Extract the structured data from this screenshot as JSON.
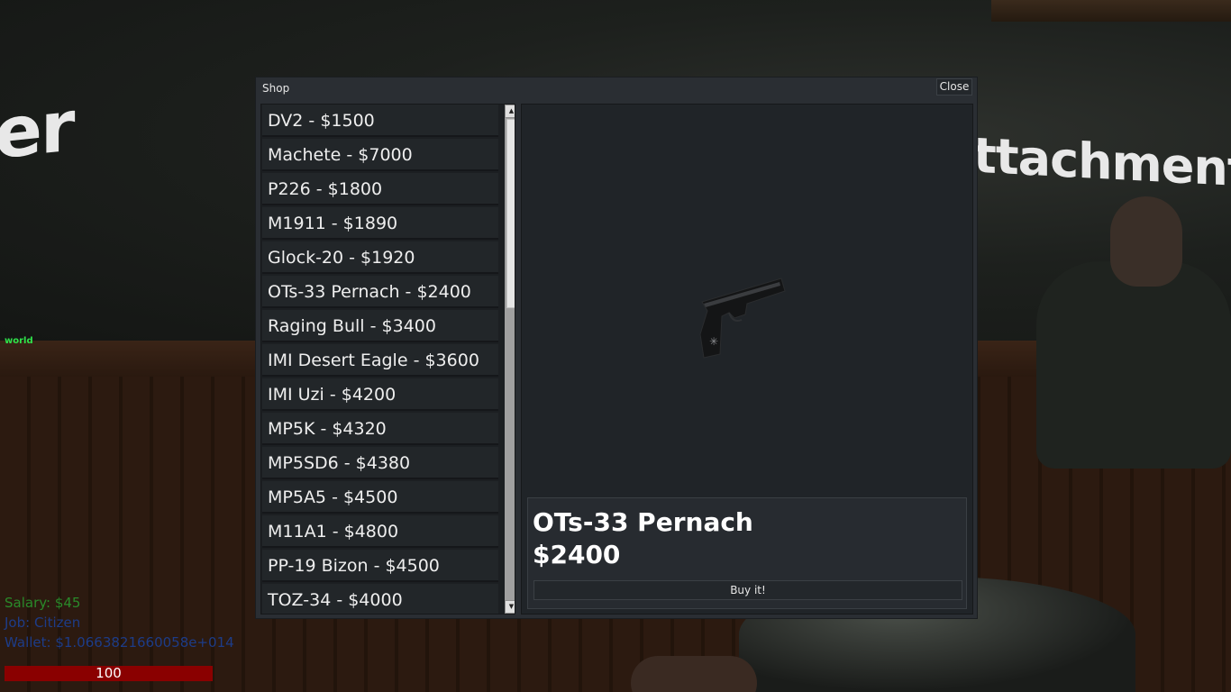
{
  "scene": {
    "sign_left_text": "er",
    "sign_right_text": "ttachment L",
    "world_tag": "world"
  },
  "hud": {
    "salary": "Salary: $45",
    "job": "Job: Citizen",
    "wallet": "Wallet: $1.0663821660058e+014",
    "health": "100"
  },
  "shop": {
    "title": "Shop",
    "close_label": "Close",
    "items": [
      {
        "label": "DV2 - $1500"
      },
      {
        "label": "Machete - $7000"
      },
      {
        "label": "P226 - $1800"
      },
      {
        "label": "M1911 - $1890"
      },
      {
        "label": "Glock-20 - $1920"
      },
      {
        "label": "OTs-33 Pernach - $2400"
      },
      {
        "label": "Raging Bull - $3400"
      },
      {
        "label": "IMI Desert Eagle - $3600"
      },
      {
        "label": "IMI Uzi - $4200"
      },
      {
        "label": "MP5K - $4320"
      },
      {
        "label": "MP5SD6 - $4380"
      },
      {
        "label": "MP5A5 - $4500"
      },
      {
        "label": "M11A1 - $4800"
      },
      {
        "label": "PP-19 Bizon - $4500"
      },
      {
        "label": "TOZ-34 - $4000"
      }
    ],
    "selected": {
      "name": "OTs-33 Pernach",
      "price": "$2400",
      "buy_label": "Buy it!"
    }
  }
}
